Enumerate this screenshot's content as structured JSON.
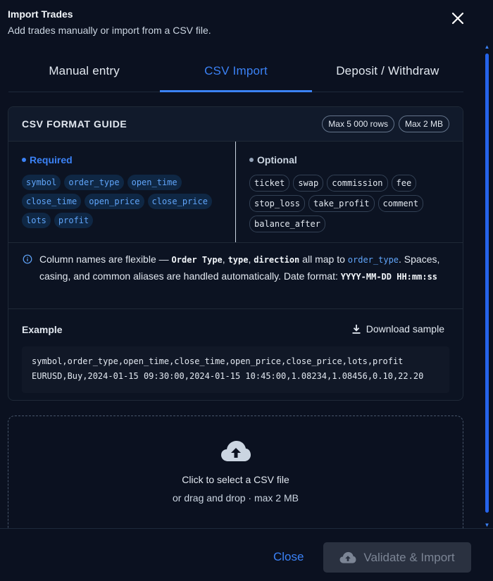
{
  "header": {
    "title": "Import Trades",
    "subtitle": "Add trades manually or import from a CSV file."
  },
  "tabs": [
    {
      "label": "Manual entry",
      "active": false
    },
    {
      "label": "CSV Import",
      "active": true
    },
    {
      "label": "Deposit / Withdraw",
      "active": false
    }
  ],
  "guide": {
    "title": "CSV FORMAT GUIDE",
    "badges": [
      "Max 5 000 rows",
      "Max 2 MB"
    ],
    "required": {
      "title": "Required",
      "fields": [
        "symbol",
        "order_type",
        "open_time",
        "close_time",
        "open_price",
        "close_price",
        "lots",
        "profit"
      ]
    },
    "optional": {
      "title": "Optional",
      "fields": [
        "ticket",
        "swap",
        "commission",
        "fee",
        "stop_loss",
        "take_profit",
        "comment",
        "balance_after"
      ]
    },
    "note": {
      "prefix": "Column names are flexible — ",
      "alias1": "Order Type",
      "sep1": ", ",
      "alias2": "type",
      "sep2": ", ",
      "alias3": "direction",
      "mid": " all map to ",
      "target": "order_type",
      "suffix": ". Spaces, casing, and common aliases are handled automatically. Date format: ",
      "date_format": "YYYY-MM-DD HH:mm:ss"
    },
    "example": {
      "title": "Example",
      "download_label": "Download sample",
      "lines": [
        "symbol,order_type,open_time,close_time,open_price,close_price,lots,profit",
        "EURUSD,Buy,2024-01-15 09:30:00,2024-01-15 10:45:00,1.08234,1.08456,0.10,22.20"
      ]
    }
  },
  "dropzone": {
    "main": "Click to select a CSV file",
    "sub": "or drag and drop · max 2 MB"
  },
  "footer": {
    "close_label": "Close",
    "import_label": "Validate & Import"
  },
  "colors": {
    "accent": "#3b82f6",
    "background": "#0b1120"
  }
}
